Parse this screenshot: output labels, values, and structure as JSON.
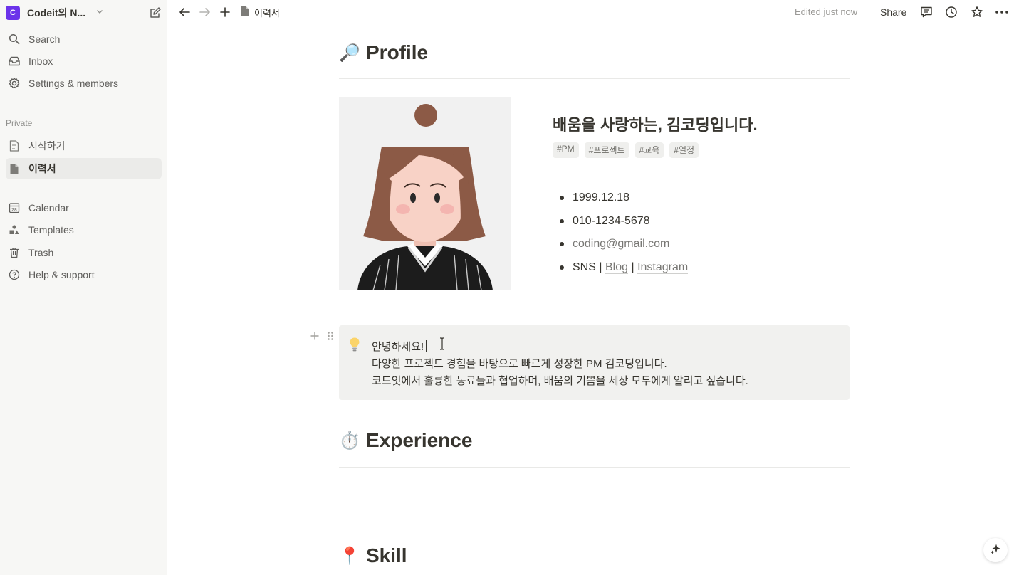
{
  "sidebar": {
    "workspace": {
      "logo_letter": "C",
      "name": "Codeit의 N...",
      "logo_color": "#6b33ea"
    },
    "top_items": [
      {
        "label": "Search",
        "icon": "search-icon"
      },
      {
        "label": "Inbox",
        "icon": "inbox-icon"
      },
      {
        "label": "Settings & members",
        "icon": "gear-icon"
      }
    ],
    "section_label": "Private",
    "pages": [
      {
        "label": "시작하기",
        "icon": "page-icon"
      },
      {
        "label": "이력서",
        "icon": "page-icon",
        "active": true
      }
    ],
    "bottom_items": [
      {
        "label": "Calendar",
        "icon": "calendar-icon"
      },
      {
        "label": "Templates",
        "icon": "templates-icon"
      },
      {
        "label": "Trash",
        "icon": "trash-icon"
      },
      {
        "label": "Help & support",
        "icon": "help-icon"
      }
    ]
  },
  "topbar": {
    "breadcrumb": "이력서",
    "edited": "Edited just now",
    "share": "Share"
  },
  "content": {
    "profile_heading": "Profile",
    "profile_emoji": "🔎",
    "tagline": "배움을 사랑하는, 김코딩입니다.",
    "tags": [
      "#PM",
      "#프로젝트",
      "#교육",
      "#열정"
    ],
    "bullets": {
      "birth": "1999.12.18",
      "phone": "010-1234-5678",
      "email": "coding@gmail.com",
      "sns_prefix": "SNS",
      "sep": "|",
      "blog": "Blog",
      "instagram": "Instagram"
    },
    "callout": {
      "emoji": "💡",
      "line1": "안녕하세요!",
      "line2": "다양한 프로젝트 경험을 바탕으로 빠르게 성장한 PM 김코딩입니다.",
      "line3": "코드잇에서 훌륭한 동료들과 협업하며, 배움의 기쁨을 세상 모두에게 알리고 싶습니다."
    },
    "experience_heading": "Experience",
    "experience_emoji": "⏱️",
    "skill_heading": "Skill",
    "skill_emoji": "📍"
  }
}
